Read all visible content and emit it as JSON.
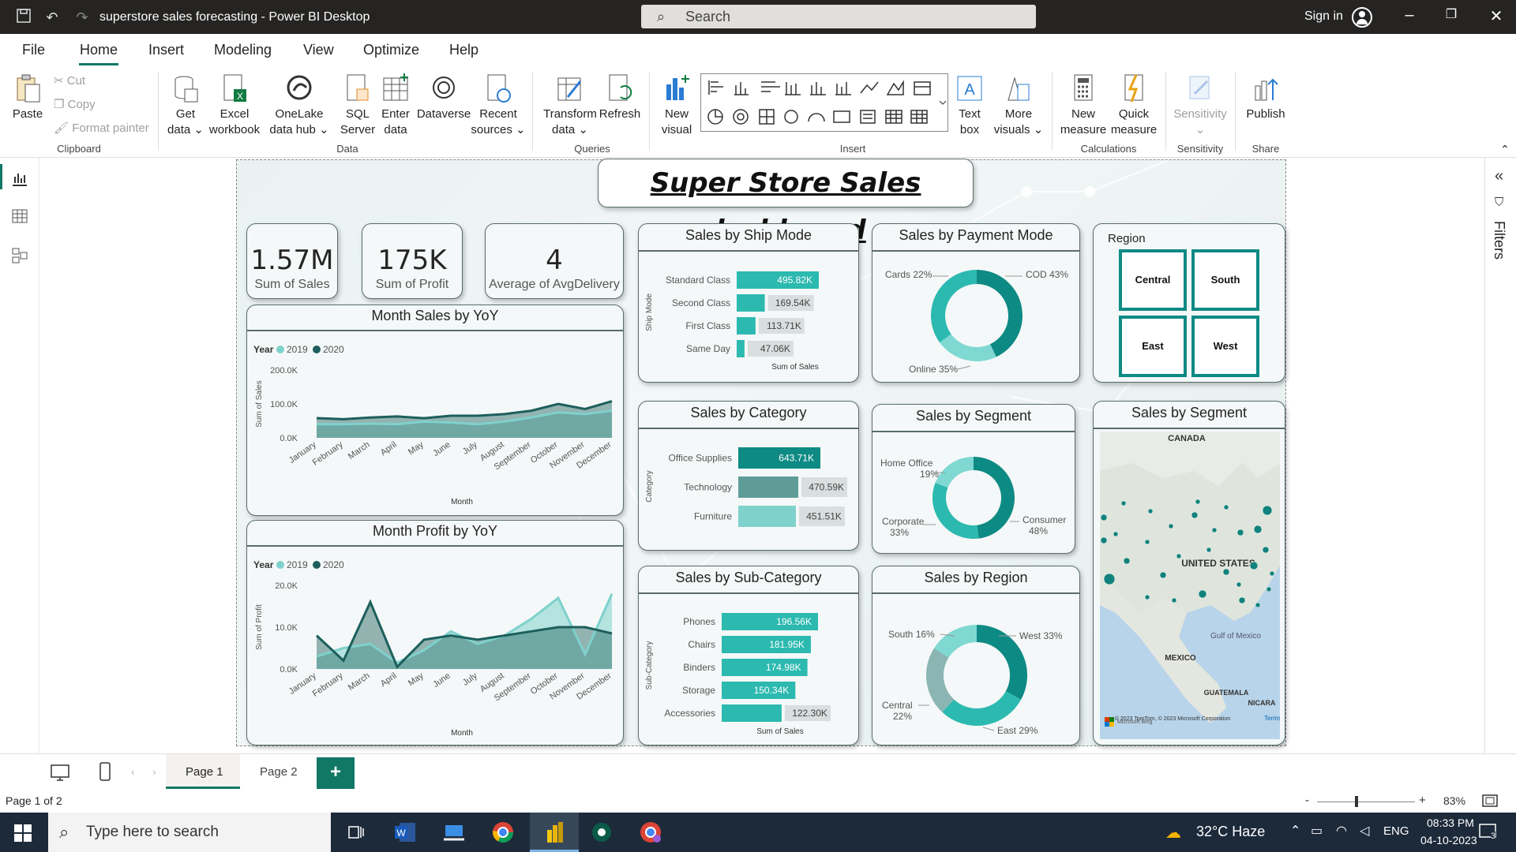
{
  "window": {
    "title": "superstore sales forecasting - Power BI Desktop",
    "search_placeholder": "Search",
    "sign_in": "Sign in"
  },
  "menu": {
    "items": [
      "File",
      "Home",
      "Insert",
      "Modeling",
      "View",
      "Optimize",
      "Help"
    ]
  },
  "ribbon": {
    "clipboard": {
      "paste": "Paste",
      "cut": "Cut",
      "copy": "Copy",
      "format_painter": "Format painter",
      "label": "Clipboard"
    },
    "data": {
      "get_data": "Get data",
      "excel": "Excel workbook",
      "onelake": "OneLake data hub",
      "sql": "SQL Server",
      "enter": "Enter data",
      "dataverse": "Dataverse",
      "recent": "Recent sources",
      "label": "Data"
    },
    "queries": {
      "transform": "Transform data",
      "refresh": "Refresh",
      "label": "Queries"
    },
    "insert": {
      "new_visual": "New visual",
      "text_box": "Text box",
      "more_visuals": "More visuals",
      "label": "Insert"
    },
    "calculations": {
      "new_measure": "New measure",
      "quick_measure": "Quick measure",
      "label": "Calculations"
    },
    "sensitivity": {
      "sensitivity": "Sensitivity",
      "label": "Sensitivity"
    },
    "share": {
      "publish": "Publish",
      "label": "Share"
    }
  },
  "filters_pane": {
    "label": "Filters"
  },
  "dashboard": {
    "title": "Super Store Sales dashboard",
    "kpis": [
      {
        "value": "1.57M",
        "label": "Sum of Sales"
      },
      {
        "value": "175K",
        "label": "Sum of Profit"
      },
      {
        "value": "4",
        "label": "Average of AvgDelivery"
      }
    ],
    "region_slicer": {
      "title": "Region",
      "items": [
        "Central",
        "South",
        "East",
        "West"
      ]
    },
    "map": {
      "title": "Sales by Segment",
      "labels": [
        "CANADA",
        "UNITED STATES",
        "MEXICO",
        "Gulf of Mexico",
        "GUATEMALA",
        "NICARA"
      ],
      "credit": "© 2023 TomTom, © 2023 Microsoft Corporation",
      "terms": "Terms",
      "bing": "Microsoft Bing"
    }
  },
  "chart_data": [
    {
      "type": "area",
      "title": "Month Sales by YoY",
      "legend_title": "Year",
      "xlabel": "Month",
      "ylabel": "Sum of Sales",
      "yticks": [
        "200.0K",
        "100.0K",
        "0.0K"
      ],
      "ylim": [
        0,
        200000
      ],
      "categories": [
        "January",
        "February",
        "March",
        "April",
        "May",
        "June",
        "July",
        "August",
        "September",
        "October",
        "November",
        "December"
      ],
      "series": [
        {
          "name": "2019",
          "color": "#7fd1cc",
          "values": [
            40000,
            40000,
            42000,
            40000,
            48000,
            45000,
            40000,
            48000,
            60000,
            75000,
            70000,
            80000
          ]
        },
        {
          "name": "2020",
          "color": "#1d5f5c",
          "values": [
            58000,
            55000,
            60000,
            63000,
            58000,
            65000,
            65000,
            70000,
            80000,
            100000,
            85000,
            108000
          ]
        }
      ]
    },
    {
      "type": "area",
      "title": "Month Profit by YoY",
      "legend_title": "Year",
      "xlabel": "Month",
      "ylabel": "Sum of Profit",
      "yticks": [
        "20.0K",
        "10.0K",
        "0.0K"
      ],
      "ylim": [
        0,
        20000
      ],
      "categories": [
        "January",
        "February",
        "March",
        "April",
        "May",
        "June",
        "July",
        "August",
        "September",
        "October",
        "November",
        "December"
      ],
      "series": [
        {
          "name": "2019",
          "color": "#7fd1cc",
          "values": [
            3000,
            5000,
            6000,
            1500,
            4500,
            9000,
            6000,
            8000,
            12000,
            17000,
            3500,
            18000
          ]
        },
        {
          "name": "2020",
          "color": "#1d5f5c",
          "values": [
            8000,
            2000,
            16000,
            500,
            7000,
            8000,
            7000,
            8000,
            9000,
            10000,
            10000,
            8500
          ]
        }
      ]
    },
    {
      "type": "bar",
      "title": "Sales by Ship Mode",
      "xlabel": "Sum of Sales",
      "ylabel": "Ship Mode",
      "categories": [
        "Standard Class",
        "Second Class",
        "First Class",
        "Same Day"
      ],
      "values": [
        495820,
        169540,
        113710,
        47060
      ],
      "labels": [
        "495.82K",
        "169.54K",
        "113.71K",
        "47.06K"
      ]
    },
    {
      "type": "bar",
      "title": "Sales by Category",
      "xlabel": "",
      "ylabel": "Category",
      "categories": [
        "Office Supplies",
        "Technology",
        "Furniture"
      ],
      "values": [
        643710,
        470590,
        451510
      ],
      "labels": [
        "643.71K",
        "470.59K",
        "451.51K"
      ]
    },
    {
      "type": "bar",
      "title": "Sales by Sub-Category",
      "xlabel": "Sum of Sales",
      "ylabel": "Sub-Category",
      "categories": [
        "Phones",
        "Chairs",
        "Binders",
        "Storage",
        "Accessories"
      ],
      "values": [
        196560,
        181950,
        174980,
        150340,
        122300
      ],
      "labels": [
        "196.56K",
        "181.95K",
        "174.98K",
        "150.34K",
        "122.30K"
      ]
    },
    {
      "type": "pie",
      "title": "Sales by Payment Mode",
      "categories": [
        "COD",
        "Cards",
        "Online"
      ],
      "values": [
        43,
        22,
        35
      ],
      "labels": [
        "COD 43%",
        "Cards 22%",
        "Online 35%"
      ],
      "colors": [
        "#0e8a84",
        "#7fd8d2",
        "#2cb9b0"
      ]
    },
    {
      "type": "pie",
      "title": "Sales by Segment",
      "categories": [
        "Consumer",
        "Corporate",
        "Home Office"
      ],
      "values": [
        48,
        33,
        19
      ],
      "labels": [
        "Consumer",
        "Corporate",
        "Home Office"
      ],
      "pct": [
        "48%",
        "33%",
        "19%"
      ],
      "colors": [
        "#0e8a84",
        "#2cb9b0",
        "#7fd8d2"
      ]
    },
    {
      "type": "pie",
      "title": "Sales by Region",
      "categories": [
        "West",
        "East",
        "Central",
        "South"
      ],
      "values": [
        33,
        29,
        22,
        16
      ],
      "labels": [
        "West 33%",
        "East 29%",
        "Central",
        "South 16%"
      ],
      "pct2": "22%",
      "colors": [
        "#0e8a84",
        "#2cb9b0",
        "#8ab5b3",
        "#7fd8d2"
      ]
    }
  ],
  "status": {
    "page_info": "Page 1 of 2",
    "pages": [
      "Page 1",
      "Page 2"
    ],
    "add_page": "+",
    "zoom": "83%",
    "zoom_minus": "-",
    "zoom_plus": "+"
  },
  "taskbar": {
    "search_placeholder": "Type here to search",
    "weather": "32°C Haze",
    "lang": "ENG",
    "time": "08:33 PM",
    "date": "04-10-2023",
    "notifications": "3"
  }
}
